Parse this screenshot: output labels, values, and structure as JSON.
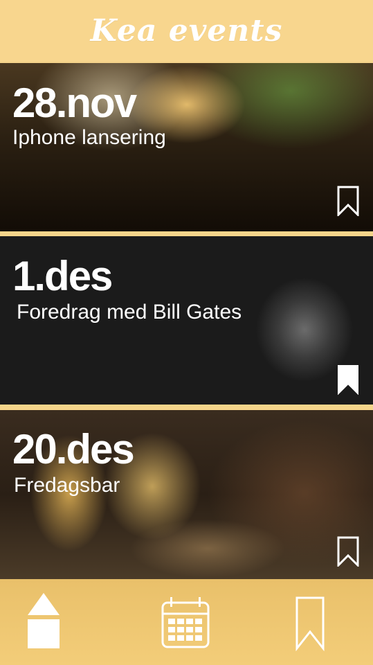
{
  "header": {
    "title": "Kea events"
  },
  "events": [
    {
      "date": "28.nov",
      "name": "Iphone lansering",
      "bookmark_icon": "bookmark-outline-icon"
    },
    {
      "date": "1.des",
      "name": "Foredrag med Bill Gates",
      "bookmark_icon": "bookmark-filled-icon"
    },
    {
      "date": "20.des",
      "name": "Fredagsbar",
      "bookmark_icon": "bookmark-outline-icon"
    }
  ],
  "nav": [
    {
      "icon": "home-icon"
    },
    {
      "icon": "calendar-icon"
    },
    {
      "icon": "bookmark-icon"
    }
  ],
  "colors": {
    "accent": "#f6d48b",
    "text": "#ffffff"
  }
}
